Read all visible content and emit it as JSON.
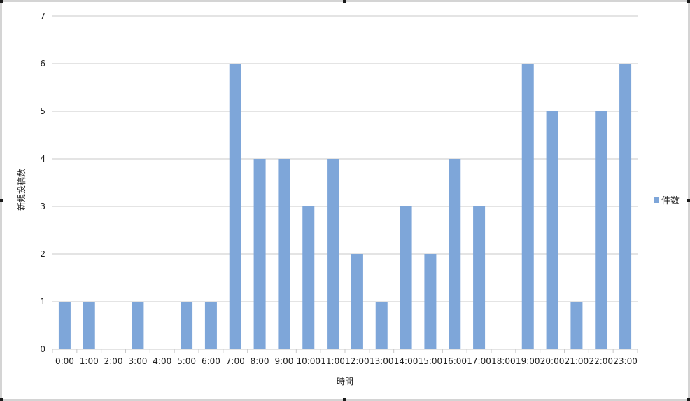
{
  "chart_data": {
    "type": "bar",
    "title": "",
    "xlabel": "時間",
    "ylabel": "新規投稿数",
    "ylim": [
      0,
      7
    ],
    "yticks": [
      "0",
      "1",
      "2",
      "3",
      "4",
      "5",
      "6",
      "7"
    ],
    "grid": true,
    "legend_position": "right",
    "categories": [
      "0:00",
      "1:00",
      "2:00",
      "3:00",
      "4:00",
      "5:00",
      "6:00",
      "7:00",
      "8:00",
      "9:00",
      "10:00",
      "11:00",
      "12:00",
      "13:00",
      "14:00",
      "15:00",
      "16:00",
      "17:00",
      "18:00",
      "19:00",
      "20:00",
      "21:00",
      "22:00",
      "23:00"
    ],
    "series": [
      {
        "name": "件数",
        "color": "#7ea6d9",
        "values": [
          1,
          1,
          0,
          1,
          0,
          1,
          1,
          6,
          4,
          4,
          3,
          4,
          2,
          1,
          3,
          2,
          4,
          3,
          0,
          6,
          5,
          1,
          5,
          6
        ]
      }
    ]
  }
}
